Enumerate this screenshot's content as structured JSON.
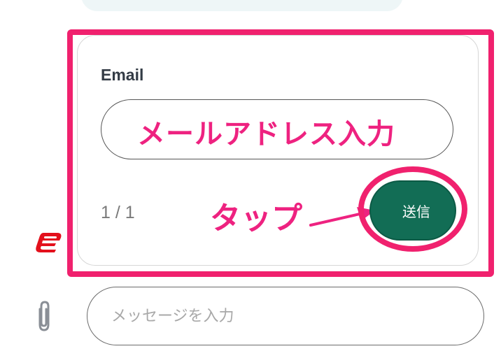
{
  "form": {
    "field_label": "Email",
    "page_indicator": "1 / 1",
    "send_label": "送信"
  },
  "annotations": {
    "email_hint": "メールアドレス入力",
    "tap_hint": "タップ"
  },
  "composer": {
    "placeholder": "メッセージを入力"
  },
  "colors": {
    "annotation_pink": "#f0216e",
    "send_button_green": "#126d55",
    "logo_red": "#e3101c"
  },
  "icons": {
    "attach": "paperclip-icon",
    "logo": "brand-logo-icon"
  }
}
